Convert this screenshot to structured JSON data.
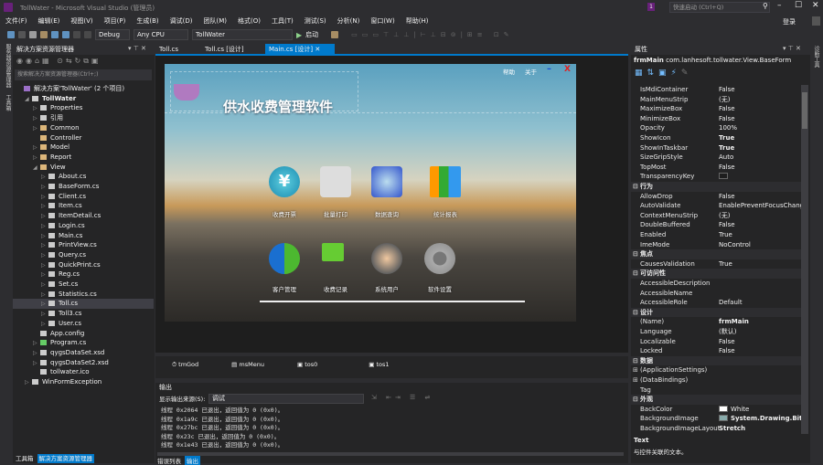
{
  "window": {
    "title": "TollWater - Microsoft Visual Studio (管理员)",
    "quick_launch_placeholder": "快速启动 (Ctrl+Q)",
    "notification_count": "1",
    "signin": "登录"
  },
  "menu": [
    "文件(F)",
    "编辑(E)",
    "视图(V)",
    "项目(P)",
    "生成(B)",
    "调试(D)",
    "团队(M)",
    "格式(O)",
    "工具(T)",
    "测试(S)",
    "分析(N)",
    "窗口(W)",
    "帮助(H)"
  ],
  "toolbar": {
    "config": "Debug",
    "platform": "Any CPU",
    "project": "TollWater",
    "start": "启动"
  },
  "side_strip": {
    "left": [
      "服务器资源管理器",
      "工具箱"
    ],
    "right": [
      "诊断工具"
    ]
  },
  "solution_explorer": {
    "title": "解决方案资源管理器",
    "search_placeholder": "搜索解决方案资源管理器(Ctrl+;)",
    "items": [
      {
        "label": "解决方案'TollWater' (2 个项目)",
        "depth": 0,
        "icon": "solution",
        "arrow": ""
      },
      {
        "label": "TollWater",
        "depth": 1,
        "icon": "project",
        "arrow": "expanded",
        "bold": true
      },
      {
        "label": "Properties",
        "depth": 2,
        "icon": "wrench",
        "arrow": "collapsed"
      },
      {
        "label": "引用",
        "depth": 2,
        "icon": "references",
        "arrow": "collapsed"
      },
      {
        "label": "Common",
        "depth": 2,
        "icon": "folder",
        "arrow": "collapsed"
      },
      {
        "label": "Controller",
        "depth": 2,
        "icon": "folder",
        "arrow": ""
      },
      {
        "label": "Model",
        "depth": 2,
        "icon": "folder",
        "arrow": "collapsed"
      },
      {
        "label": "Report",
        "depth": 2,
        "icon": "folder",
        "arrow": "collapsed"
      },
      {
        "label": "View",
        "depth": 2,
        "icon": "folder-open",
        "arrow": "expanded"
      },
      {
        "label": "About.cs",
        "depth": 3,
        "icon": "form",
        "arrow": "collapsed"
      },
      {
        "label": "BaseForm.cs",
        "depth": 3,
        "icon": "form",
        "arrow": "collapsed"
      },
      {
        "label": "Client.cs",
        "depth": 3,
        "icon": "form",
        "arrow": "collapsed"
      },
      {
        "label": "Item.cs",
        "depth": 3,
        "icon": "form",
        "arrow": "collapsed"
      },
      {
        "label": "ItemDetail.cs",
        "depth": 3,
        "icon": "form",
        "arrow": "collapsed"
      },
      {
        "label": "Login.cs",
        "depth": 3,
        "icon": "form",
        "arrow": "collapsed"
      },
      {
        "label": "Main.cs",
        "depth": 3,
        "icon": "form",
        "arrow": "collapsed"
      },
      {
        "label": "PrintView.cs",
        "depth": 3,
        "icon": "form",
        "arrow": "collapsed"
      },
      {
        "label": "Query.cs",
        "depth": 3,
        "icon": "form",
        "arrow": "collapsed"
      },
      {
        "label": "QuickPrint.cs",
        "depth": 3,
        "icon": "form",
        "arrow": "collapsed"
      },
      {
        "label": "Reg.cs",
        "depth": 3,
        "icon": "form",
        "arrow": "collapsed"
      },
      {
        "label": "Set.cs",
        "depth": 3,
        "icon": "form",
        "arrow": "collapsed"
      },
      {
        "label": "Statistics.cs",
        "depth": 3,
        "icon": "form",
        "arrow": "collapsed"
      },
      {
        "label": "Toll.cs",
        "depth": 3,
        "icon": "form",
        "arrow": "collapsed",
        "selected": true
      },
      {
        "label": "Toll3.cs",
        "depth": 3,
        "icon": "form",
        "arrow": "collapsed"
      },
      {
        "label": "User.cs",
        "depth": 3,
        "icon": "form",
        "arrow": "collapsed"
      },
      {
        "label": "App.config",
        "depth": 2,
        "icon": "config",
        "arrow": ""
      },
      {
        "label": "Program.cs",
        "depth": 2,
        "icon": "csharp",
        "arrow": "collapsed"
      },
      {
        "label": "qygsDataSet.xsd",
        "depth": 2,
        "icon": "dataset",
        "arrow": "collapsed"
      },
      {
        "label": "qygsDataSet2.xsd",
        "depth": 2,
        "icon": "dataset",
        "arrow": "collapsed"
      },
      {
        "label": "tollwater.ico",
        "depth": 2,
        "icon": "ico",
        "arrow": ""
      },
      {
        "label": "WinFormException",
        "depth": 1,
        "icon": "project",
        "arrow": "collapsed"
      }
    ],
    "bottom_tabs": [
      "工具箱",
      "解决方案资源管理器"
    ]
  },
  "editor_tabs": [
    {
      "label": "Toll.cs"
    },
    {
      "label": "Toll.cs [设计]"
    },
    {
      "label": "Main.cs [设计]",
      "active": true
    }
  ],
  "form_preview": {
    "title": "供水收费管理软件",
    "top_links": [
      "帮助",
      "关于"
    ],
    "row1": [
      "收费开票",
      "批量打印",
      "数据查询",
      "统计报表"
    ],
    "row2": [
      "客户管理",
      "收费记录",
      "系统用户",
      "软件设置"
    ]
  },
  "component_tray": [
    "tmGod",
    "msMenu",
    "tos0",
    "tos1"
  ],
  "output": {
    "title": "输出",
    "source_label": "显示输出来源(S):",
    "source_value": "调试",
    "lines": [
      "线程 0x2064 已退出，返回值为 0 (0x0)。",
      "线程 0x1a9c 已退出，返回值为 0 (0x0)。",
      "线程 0x27bc 已退出，返回值为 0 (0x0)。",
      "线程 0x23c 已退出，返回值为 0 (0x0)。",
      "线程 0x1e43 已退出，返回值为 0 (0x0)。"
    ],
    "bottom_tabs": [
      "错误列表",
      "输出"
    ]
  },
  "properties": {
    "title": "属性",
    "object_name": "frmMain",
    "object_type": "com.lanhesoft.tollwater.View.BaseForm",
    "rows": [
      {
        "k": "IsMdiContainer",
        "v": "False"
      },
      {
        "k": "MainMenuStrip",
        "v": "(无)"
      },
      {
        "k": "MaximizeBox",
        "v": "False"
      },
      {
        "k": "MinimizeBox",
        "v": "False"
      },
      {
        "k": "Opacity",
        "v": "100%"
      },
      {
        "k": "ShowIcon",
        "v": "True",
        "bold": true
      },
      {
        "k": "ShowInTaskbar",
        "v": "True",
        "bold": true
      },
      {
        "k": "SizeGripStyle",
        "v": "Auto"
      },
      {
        "k": "TopMost",
        "v": "False"
      },
      {
        "k": "TransparencyKey",
        "v": "",
        "swatch": "#1e1e1e"
      },
      {
        "k": "行为",
        "cat": true
      },
      {
        "k": "AllowDrop",
        "v": "False"
      },
      {
        "k": "AutoValidate",
        "v": "EnablePreventFocusChange"
      },
      {
        "k": "ContextMenuStrip",
        "v": "(无)"
      },
      {
        "k": "DoubleBuffered",
        "v": "False"
      },
      {
        "k": "Enabled",
        "v": "True"
      },
      {
        "k": "ImeMode",
        "v": "NoControl"
      },
      {
        "k": "焦点",
        "cat": true
      },
      {
        "k": "CausesValidation",
        "v": "True"
      },
      {
        "k": "可访问性",
        "cat": true
      },
      {
        "k": "AccessibleDescription",
        "v": ""
      },
      {
        "k": "AccessibleName",
        "v": ""
      },
      {
        "k": "AccessibleRole",
        "v": "Default"
      },
      {
        "k": "设计",
        "cat": true
      },
      {
        "k": "(Name)",
        "v": "frmMain",
        "bold": true
      },
      {
        "k": "Language",
        "v": "(默认)"
      },
      {
        "k": "Localizable",
        "v": "False"
      },
      {
        "k": "Locked",
        "v": "False"
      },
      {
        "k": "数据",
        "cat": true
      },
      {
        "k": "(ApplicationSettings)",
        "v": "",
        "expand": true
      },
      {
        "k": "(DataBindings)",
        "v": "",
        "expand": true
      },
      {
        "k": "Tag",
        "v": ""
      },
      {
        "k": "外观",
        "cat": true
      },
      {
        "k": "BackColor",
        "v": "White",
        "swatch": "#ffffff"
      },
      {
        "k": "BackgroundImage",
        "v": "System.Drawing.Bitm",
        "bold": true,
        "swatch": "#8aa"
      },
      {
        "k": "BackgroundImageLayout",
        "v": "Stretch",
        "bold": true
      }
    ],
    "description_title": "Text",
    "description": "与控件关联的文本。"
  },
  "colors": {
    "accent": "#007acc",
    "vs_purple": "#68217a",
    "bg": "#2d2d30",
    "panel": "#252526"
  }
}
